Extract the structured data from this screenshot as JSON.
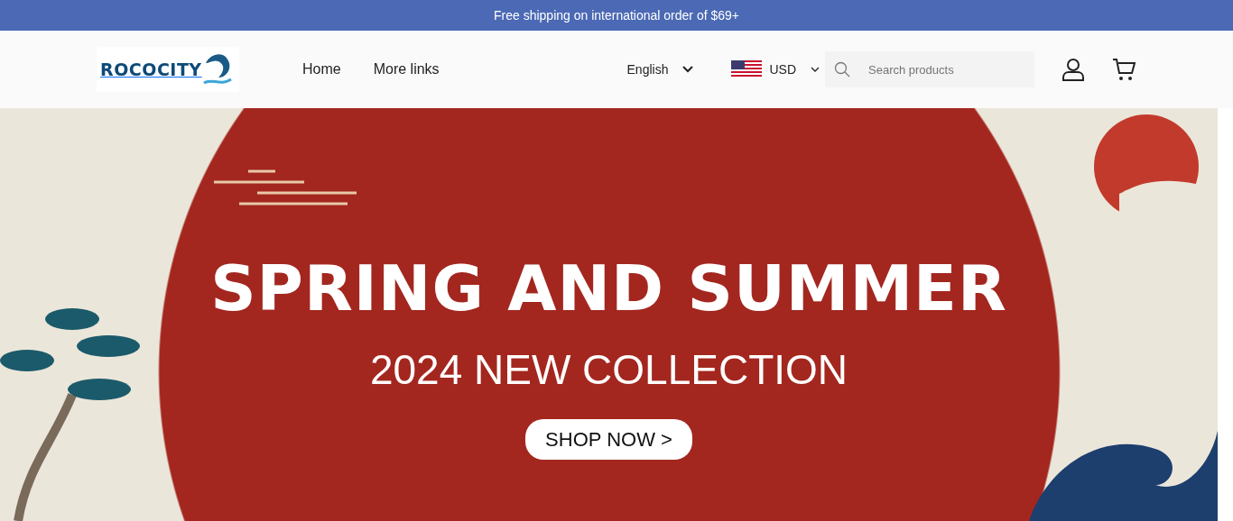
{
  "announcement": {
    "text": "Free shipping on international order of $69+"
  },
  "header": {
    "logo": {
      "text": "ROCOCITY"
    },
    "nav": [
      {
        "label": "Home"
      },
      {
        "label": "More links"
      }
    ],
    "language": {
      "value": "English"
    },
    "currency": {
      "value": "USD"
    },
    "search": {
      "placeholder": "Search products"
    }
  },
  "hero": {
    "title": "SPRING AND SUMMER",
    "subtitle": "2024 NEW COLLECTION",
    "button": "SHOP NOW >"
  }
}
